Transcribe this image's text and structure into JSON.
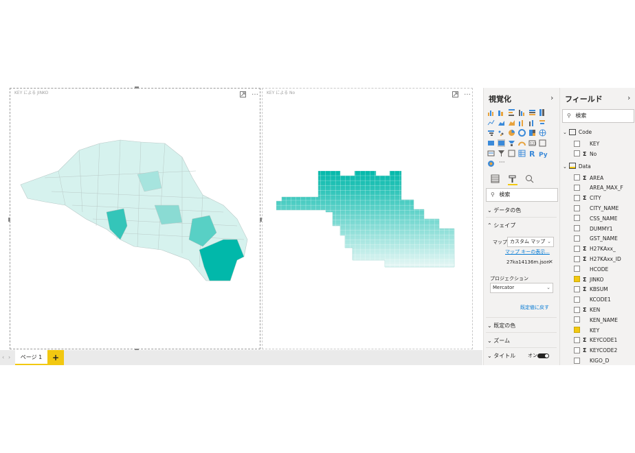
{
  "visuals": [
    {
      "title": "KEY による JINKO",
      "more": "…"
    },
    {
      "title": "KEY による No",
      "more": "…"
    }
  ],
  "pages": {
    "tabs": [
      "ページ 1"
    ],
    "add": "+"
  },
  "viz_pane": {
    "title": "視覚化",
    "search_placeholder": "検索",
    "sections": {
      "data_colors": "データの色",
      "shape": "シェイプ",
      "default_colors": "既定の色",
      "zoom": "ズーム",
      "title": "タイトル"
    },
    "map_label": "マップ",
    "map_value": "カスタム マップ",
    "map_keys_link": "マップ キーの表示...",
    "map_file": "27ka14136m.json",
    "projection_label": "プロジェクション",
    "projection_value": "Mercator",
    "reset_link": "既定値に戻す",
    "title_toggle": "オン",
    "more_dots": "···"
  },
  "fields_pane": {
    "title": "フィールド",
    "search_placeholder": "検索",
    "tables": [
      {
        "name": "Code",
        "fields": [
          {
            "name": "KEY",
            "sigma": false,
            "checked": false
          },
          {
            "name": "No",
            "sigma": true,
            "checked": false
          }
        ]
      },
      {
        "name": "Data",
        "fields": [
          {
            "name": "AREA",
            "sigma": true,
            "checked": false
          },
          {
            "name": "AREA_MAX_F",
            "sigma": false,
            "checked": false
          },
          {
            "name": "CITY",
            "sigma": true,
            "checked": false
          },
          {
            "name": "CITY_NAME",
            "sigma": false,
            "checked": false
          },
          {
            "name": "CSS_NAME",
            "sigma": false,
            "checked": false
          },
          {
            "name": "DUMMY1",
            "sigma": false,
            "checked": false
          },
          {
            "name": "GST_NAME",
            "sigma": false,
            "checked": false
          },
          {
            "name": "H27KAxx_",
            "sigma": true,
            "checked": false
          },
          {
            "name": "H27KAxx_ID",
            "sigma": true,
            "checked": false
          },
          {
            "name": "HCODE",
            "sigma": false,
            "checked": false
          },
          {
            "name": "JINKO",
            "sigma": true,
            "checked": true
          },
          {
            "name": "KBSUM",
            "sigma": true,
            "checked": false
          },
          {
            "name": "KCODE1",
            "sigma": false,
            "checked": false
          },
          {
            "name": "KEN",
            "sigma": true,
            "checked": false
          },
          {
            "name": "KEN_NAME",
            "sigma": false,
            "checked": false
          },
          {
            "name": "KEY",
            "sigma": false,
            "checked": true
          },
          {
            "name": "KEYCODE1",
            "sigma": true,
            "checked": false
          },
          {
            "name": "KEYCODE2",
            "sigma": true,
            "checked": false
          },
          {
            "name": "KIGO_D",
            "sigma": false,
            "checked": false
          }
        ]
      }
    ]
  },
  "colors": {
    "accent": "#f2c811",
    "map_dark": "#01b8aa",
    "map_light": "#e6f7f5",
    "link": "#0078d4"
  }
}
